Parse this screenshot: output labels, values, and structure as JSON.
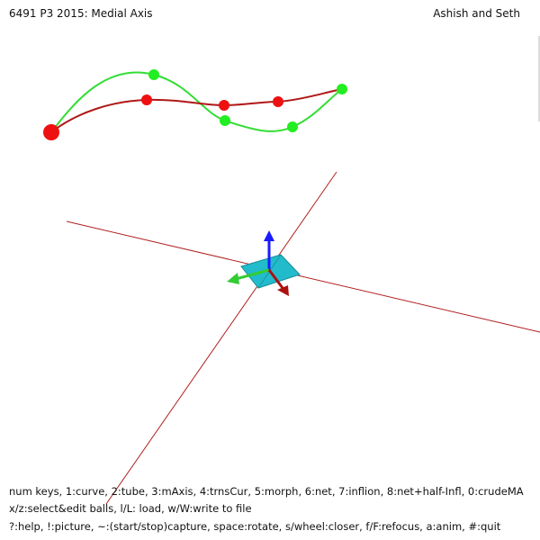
{
  "header": {
    "title": "6491 P3 2015: Medial Axis",
    "authors": "Ashish and Seth"
  },
  "help": {
    "line1": "num keys, 1:curve, 2:tube, 3:mAxis, 4:trnsCur, 5:morph, 6:net, 7:inflion, 8:net+half-Infl, 0:crudeMA",
    "line2": "x/z:select&edit balls, l/L: load, w/W:write to file",
    "line3": "?:help, !:picture, ~:(start/stop)capture, space:rotate, s/wheel:closer, f/F:refocus, a:anim, #:quit"
  },
  "colors": {
    "red_curve": "#b01818",
    "green_curve": "#33dd33",
    "red_ball": "#ee1111",
    "green_ball": "#22ee22",
    "axis_line": "#b02020",
    "plane": "#22bbcc",
    "arrow_blue": "#1a1aff",
    "arrow_green": "#33cc33",
    "arrow_red": "#aa1111"
  },
  "scene": {
    "red_balls": 4,
    "green_balls": 4,
    "icons": [
      "frame-arrows-icon",
      "focus-plane-icon"
    ]
  }
}
